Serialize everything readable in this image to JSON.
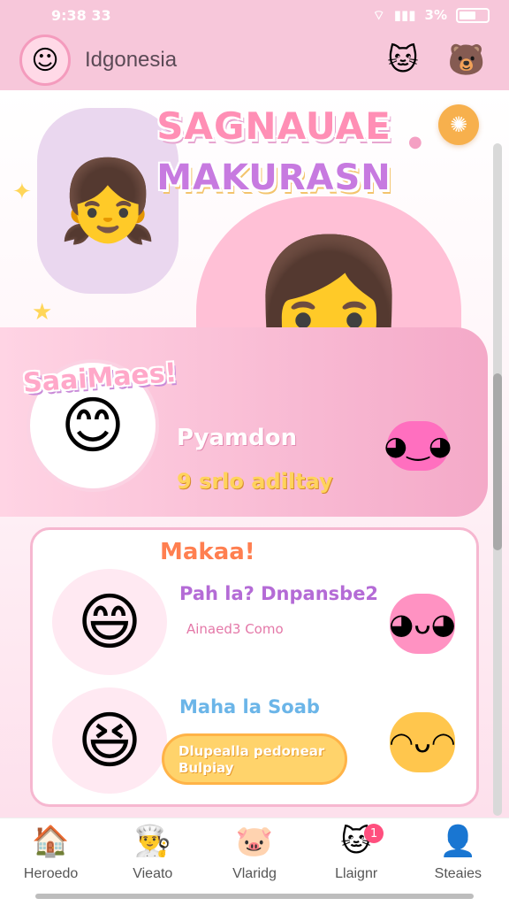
{
  "status_bar": {
    "time": "9:38 33",
    "battery": "3%"
  },
  "header": {
    "title": "Idgonesia"
  },
  "hero": {
    "title_line1": "SAGNAUAE",
    "title_line2": "MAKURASN"
  },
  "promo": {
    "sticker": "SaaiMaes!",
    "name": "Pyamdon",
    "subtitle": "9 srlo adiltay"
  },
  "list": {
    "title": "Makaa!",
    "items": [
      {
        "title": "Pah la? Dnpansbe2",
        "subtitle": "Ainaed3 Como"
      },
      {
        "title": "Maha la Soab",
        "button": "Dlupealla pedonear Bulpiay"
      }
    ]
  },
  "nav": {
    "items": [
      {
        "label": "Heroedo",
        "icon": "home-icon"
      },
      {
        "label": "Vieato",
        "icon": "chef-icon"
      },
      {
        "label": "Vlaridg",
        "icon": "pig-icon"
      },
      {
        "label": "Llaignr",
        "icon": "cat-chat-icon",
        "badge": "1"
      },
      {
        "label": "Steaies",
        "icon": "user-settings-icon"
      }
    ]
  }
}
